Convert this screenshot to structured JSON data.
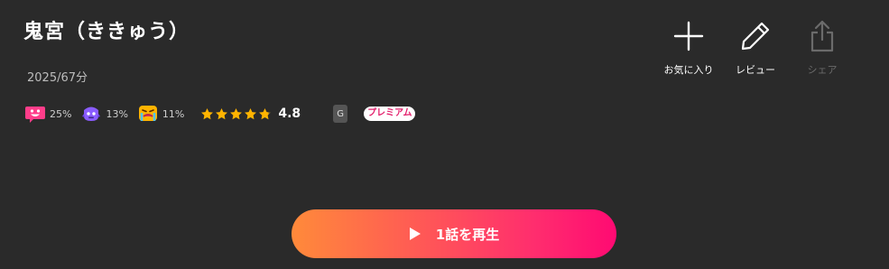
{
  "title": "鬼宮（ききゅう）",
  "meta": {
    "year_duration": "2025/67分"
  },
  "reactions": [
    {
      "icon": "grinning-face-icon",
      "percent": "25%",
      "color": "#ff3d8a"
    },
    {
      "icon": "purple-monster-face-icon",
      "percent": "13%",
      "color": "#8a5cff"
    },
    {
      "icon": "crying-face-icon",
      "percent": "11%",
      "color": "#ffb400"
    }
  ],
  "rating": {
    "value": "4.8",
    "stars": 4.8,
    "star_color": "#ffb400"
  },
  "age_rating": "G",
  "badge": "プレミアム",
  "actions": {
    "favorite": "お気に入り",
    "review": "レビュー",
    "share": "シェア"
  },
  "play_button": {
    "label": "1話を再生",
    "gradient_start": "#ff8a3a",
    "gradient_end": "#ff0a72"
  }
}
